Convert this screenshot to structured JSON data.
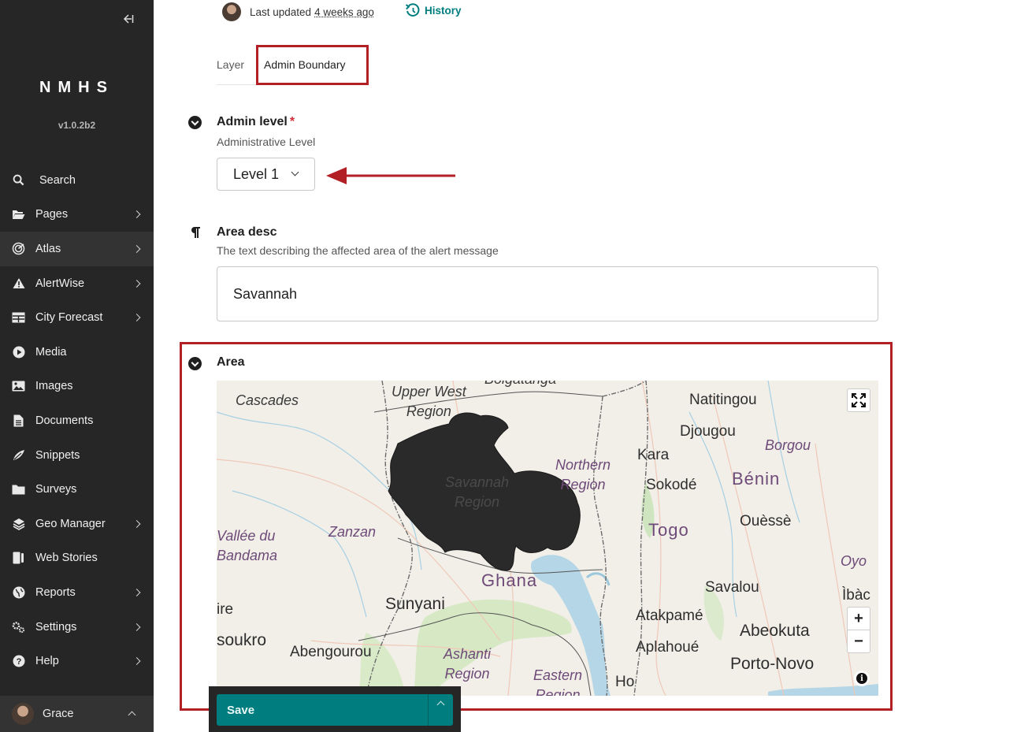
{
  "sidebar": {
    "collapse_icon": "arrow-left-bar-icon",
    "brand": "NMHS",
    "version": "v1.0.2b2",
    "items": [
      {
        "label": "Search",
        "icon": "search-icon",
        "has_children": false
      },
      {
        "label": "Pages",
        "icon": "folder-open-icon",
        "has_children": true
      },
      {
        "label": "Atlas",
        "icon": "radar-icon",
        "has_children": true,
        "active": true
      },
      {
        "label": "AlertWise",
        "icon": "warning-icon",
        "has_children": true
      },
      {
        "label": "City Forecast",
        "icon": "table-icon",
        "has_children": true
      },
      {
        "label": "Media",
        "icon": "play-icon",
        "has_children": false
      },
      {
        "label": "Images",
        "icon": "image-icon",
        "has_children": false
      },
      {
        "label": "Documents",
        "icon": "document-icon",
        "has_children": false
      },
      {
        "label": "Snippets",
        "icon": "snippet-icon",
        "has_children": false
      },
      {
        "label": "Surveys",
        "icon": "folder-icon",
        "has_children": false
      },
      {
        "label": "Geo Manager",
        "icon": "layers-icon",
        "has_children": true
      },
      {
        "label": "Web Stories",
        "icon": "stories-icon",
        "has_children": false
      },
      {
        "label": "Reports",
        "icon": "globe-icon",
        "has_children": true
      },
      {
        "label": "Settings",
        "icon": "cogs-icon",
        "has_children": true
      },
      {
        "label": "Help",
        "icon": "help-icon",
        "has_children": true
      }
    ],
    "account": {
      "name": "Grace"
    }
  },
  "header": {
    "last_updated_label": "Last updated",
    "last_updated_value": "4 weeks ago",
    "history_label": "History"
  },
  "tabs": {
    "layer_label": "Layer",
    "admin_label": "Admin Boundary"
  },
  "admin_level": {
    "label": "Admin level",
    "required_mark": "*",
    "help": "Administrative Level",
    "value": "Level 1"
  },
  "area_desc": {
    "label": "Area desc",
    "help": "The text describing the affected area of the alert message",
    "value": "Savannah"
  },
  "area": {
    "label": "Area",
    "map": {
      "labels": {
        "cascades": "Cascades",
        "upper_west": "Upper West\nRegion",
        "bolgatanga": "Bolgatanga",
        "natitingou": "Natitingou",
        "djougou": "Djougou",
        "borgou": "Borgou",
        "kara": "Kara",
        "northern": "Northern\nRegion",
        "sokode": "Sokodé",
        "benin": "Bénin",
        "savannah": "Savannah\nRegion",
        "zanzan": "Zanzan",
        "vallee": "Vallée du\nBandama",
        "togo": "Togo",
        "ouesse": "Ouèssè",
        "oyo": "Oyo",
        "ghana": "Ghana",
        "savalou": "Savalou",
        "sunyani": "Sunyani",
        "ire": "ire",
        "ibadan": "Ìbàc",
        "atakpame": "Atakpamé",
        "abeokuta": "Abeokuta",
        "soukro": "soukro",
        "abengourou": "Abengourou",
        "ashanti": "Ashanti\nRegion",
        "aplahoue": "Aplahoué",
        "porto_novo": "Porto-Novo",
        "eastern": "Eastern\nRegion",
        "ho": "Ho"
      },
      "zoom_in": "+",
      "zoom_out": "−",
      "info": "i"
    }
  },
  "footer": {
    "save_label": "Save"
  },
  "colors": {
    "sidebar_bg": "#262626",
    "accent_teal": "#007d7e",
    "highlight_red": "#b21f24",
    "required_red": "#cd2e3a",
    "selected_region": "#2a2a2a"
  }
}
